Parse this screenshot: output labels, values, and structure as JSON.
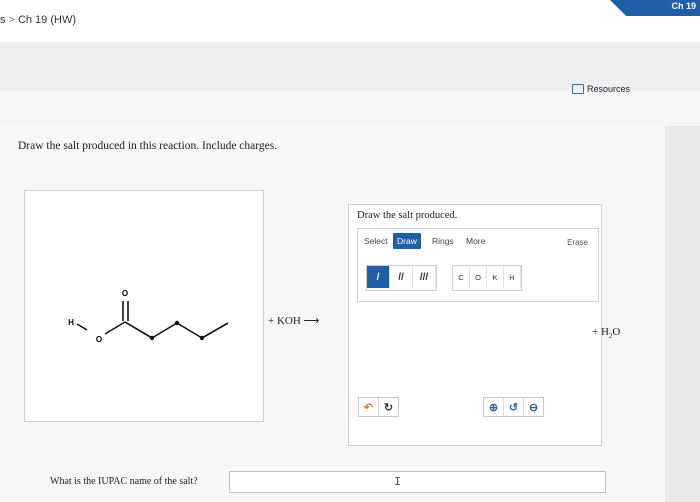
{
  "breadcrumb": {
    "prefix": "s",
    "separator": ">",
    "current": "Ch 19 (HW)"
  },
  "top_right_label": "Ch 19",
  "resources_label": "Resources",
  "question": {
    "prompt": "Draw the salt produced in this reaction. Include charges.",
    "reagent": "+ KOH ⟶",
    "byproduct_prefix": "+ H",
    "byproduct_sub": "2",
    "byproduct_suffix": "O",
    "iupac_label": "What is the IUPAC name of the salt?",
    "iupac_value": ""
  },
  "molecule": {
    "atom_O_carbonyl": "O",
    "atom_O_hydroxyl": "O",
    "atom_H": "H"
  },
  "editor": {
    "title": "Draw the salt produced.",
    "tabs": [
      "Select",
      "Draw",
      "Rings",
      "More"
    ],
    "active_tab": "Draw",
    "erase_label": "Erase",
    "bonds": [
      "/",
      "//",
      "///"
    ],
    "atoms": [
      "C",
      "O",
      "K",
      "H"
    ]
  },
  "icons": {
    "undo": "undo-icon",
    "redo": "redo-icon",
    "zoom_in": "zoom-in-icon",
    "reset_zoom": "reset-zoom-icon",
    "zoom_out": "zoom-out-icon"
  },
  "colors": {
    "accent": "#1f5fa8"
  }
}
